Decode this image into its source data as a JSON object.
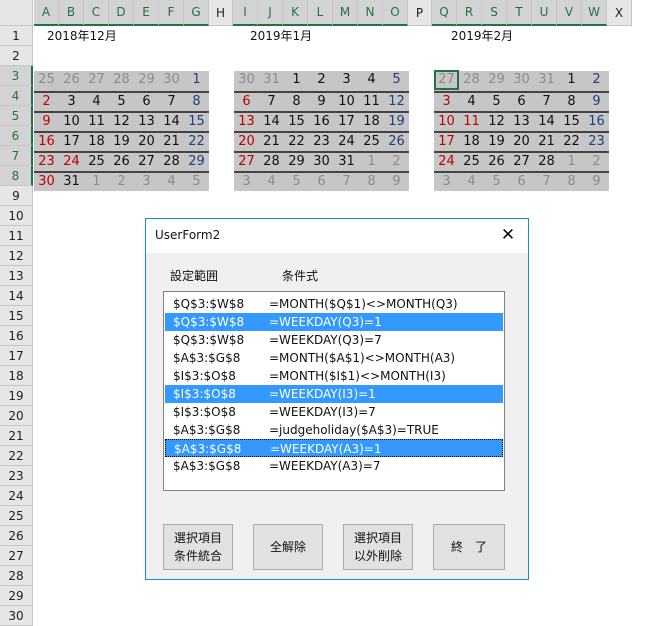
{
  "sheet": {
    "columns": [
      "A",
      "B",
      "C",
      "D",
      "E",
      "F",
      "G",
      "H",
      "I",
      "J",
      "K",
      "L",
      "M",
      "N",
      "O",
      "P",
      "Q",
      "R",
      "S",
      "T",
      "U",
      "V",
      "W",
      "X"
    ],
    "rows": [
      "1",
      "2",
      "3",
      "4",
      "5",
      "6",
      "7",
      "8",
      "9",
      "10",
      "11",
      "12",
      "13",
      "14",
      "15",
      "16",
      "17",
      "18",
      "19",
      "20",
      "21",
      "22",
      "23",
      "24",
      "25",
      "26",
      "27",
      "28",
      "29",
      "30"
    ]
  },
  "calendars": [
    {
      "title": "2018年12月",
      "weeks": [
        [
          {
            "t": "25",
            "c": "gray"
          },
          {
            "t": "26",
            "c": "gray"
          },
          {
            "t": "27",
            "c": "gray"
          },
          {
            "t": "28",
            "c": "gray"
          },
          {
            "t": "29",
            "c": "gray"
          },
          {
            "t": "30",
            "c": "gray"
          },
          {
            "t": "1",
            "c": "blue"
          }
        ],
        [
          {
            "t": "2",
            "c": "red"
          },
          {
            "t": "3",
            "c": "black"
          },
          {
            "t": "4",
            "c": "black"
          },
          {
            "t": "5",
            "c": "black"
          },
          {
            "t": "6",
            "c": "black"
          },
          {
            "t": "7",
            "c": "black"
          },
          {
            "t": "8",
            "c": "blue"
          }
        ],
        [
          {
            "t": "9",
            "c": "red"
          },
          {
            "t": "10",
            "c": "black"
          },
          {
            "t": "11",
            "c": "black"
          },
          {
            "t": "12",
            "c": "black"
          },
          {
            "t": "13",
            "c": "black"
          },
          {
            "t": "14",
            "c": "black"
          },
          {
            "t": "15",
            "c": "blue"
          }
        ],
        [
          {
            "t": "16",
            "c": "red"
          },
          {
            "t": "17",
            "c": "black"
          },
          {
            "t": "18",
            "c": "black"
          },
          {
            "t": "19",
            "c": "black"
          },
          {
            "t": "20",
            "c": "black"
          },
          {
            "t": "21",
            "c": "black"
          },
          {
            "t": "22",
            "c": "blue"
          }
        ],
        [
          {
            "t": "23",
            "c": "red"
          },
          {
            "t": "24",
            "c": "red"
          },
          {
            "t": "25",
            "c": "black"
          },
          {
            "t": "26",
            "c": "black"
          },
          {
            "t": "27",
            "c": "black"
          },
          {
            "t": "28",
            "c": "black"
          },
          {
            "t": "29",
            "c": "blue"
          }
        ],
        [
          {
            "t": "30",
            "c": "red"
          },
          {
            "t": "31",
            "c": "black"
          },
          {
            "t": "1",
            "c": "gray"
          },
          {
            "t": "2",
            "c": "gray"
          },
          {
            "t": "3",
            "c": "gray"
          },
          {
            "t": "4",
            "c": "gray"
          },
          {
            "t": "5",
            "c": "gray"
          }
        ]
      ]
    },
    {
      "title": "2019年1月",
      "weeks": [
        [
          {
            "t": "30",
            "c": "gray"
          },
          {
            "t": "31",
            "c": "gray"
          },
          {
            "t": "1",
            "c": "black"
          },
          {
            "t": "2",
            "c": "black"
          },
          {
            "t": "3",
            "c": "black"
          },
          {
            "t": "4",
            "c": "black"
          },
          {
            "t": "5",
            "c": "blue"
          }
        ],
        [
          {
            "t": "6",
            "c": "red"
          },
          {
            "t": "7",
            "c": "black"
          },
          {
            "t": "8",
            "c": "black"
          },
          {
            "t": "9",
            "c": "black"
          },
          {
            "t": "10",
            "c": "black"
          },
          {
            "t": "11",
            "c": "black"
          },
          {
            "t": "12",
            "c": "blue"
          }
        ],
        [
          {
            "t": "13",
            "c": "red"
          },
          {
            "t": "14",
            "c": "black"
          },
          {
            "t": "15",
            "c": "black"
          },
          {
            "t": "16",
            "c": "black"
          },
          {
            "t": "17",
            "c": "black"
          },
          {
            "t": "18",
            "c": "black"
          },
          {
            "t": "19",
            "c": "blue"
          }
        ],
        [
          {
            "t": "20",
            "c": "red"
          },
          {
            "t": "21",
            "c": "black"
          },
          {
            "t": "22",
            "c": "black"
          },
          {
            "t": "23",
            "c": "black"
          },
          {
            "t": "24",
            "c": "black"
          },
          {
            "t": "25",
            "c": "black"
          },
          {
            "t": "26",
            "c": "blue"
          }
        ],
        [
          {
            "t": "27",
            "c": "red"
          },
          {
            "t": "28",
            "c": "black"
          },
          {
            "t": "29",
            "c": "black"
          },
          {
            "t": "30",
            "c": "black"
          },
          {
            "t": "31",
            "c": "black"
          },
          {
            "t": "1",
            "c": "gray"
          },
          {
            "t": "2",
            "c": "gray"
          }
        ],
        [
          {
            "t": "3",
            "c": "gray"
          },
          {
            "t": "4",
            "c": "gray"
          },
          {
            "t": "5",
            "c": "gray"
          },
          {
            "t": "6",
            "c": "gray"
          },
          {
            "t": "7",
            "c": "gray"
          },
          {
            "t": "8",
            "c": "gray"
          },
          {
            "t": "9",
            "c": "gray"
          }
        ]
      ]
    },
    {
      "title": "2019年2月",
      "weeks": [
        [
          {
            "t": "27",
            "c": "gray"
          },
          {
            "t": "28",
            "c": "gray"
          },
          {
            "t": "29",
            "c": "gray"
          },
          {
            "t": "30",
            "c": "gray"
          },
          {
            "t": "31",
            "c": "gray"
          },
          {
            "t": "1",
            "c": "black"
          },
          {
            "t": "2",
            "c": "blue"
          }
        ],
        [
          {
            "t": "3",
            "c": "red"
          },
          {
            "t": "4",
            "c": "black"
          },
          {
            "t": "5",
            "c": "black"
          },
          {
            "t": "6",
            "c": "black"
          },
          {
            "t": "7",
            "c": "black"
          },
          {
            "t": "8",
            "c": "black"
          },
          {
            "t": "9",
            "c": "blue"
          }
        ],
        [
          {
            "t": "10",
            "c": "red"
          },
          {
            "t": "11",
            "c": "red"
          },
          {
            "t": "12",
            "c": "black"
          },
          {
            "t": "13",
            "c": "black"
          },
          {
            "t": "14",
            "c": "black"
          },
          {
            "t": "15",
            "c": "black"
          },
          {
            "t": "16",
            "c": "blue"
          }
        ],
        [
          {
            "t": "17",
            "c": "red"
          },
          {
            "t": "18",
            "c": "black"
          },
          {
            "t": "19",
            "c": "black"
          },
          {
            "t": "20",
            "c": "black"
          },
          {
            "t": "21",
            "c": "black"
          },
          {
            "t": "22",
            "c": "black"
          },
          {
            "t": "23",
            "c": "blue"
          }
        ],
        [
          {
            "t": "24",
            "c": "red"
          },
          {
            "t": "25",
            "c": "black"
          },
          {
            "t": "26",
            "c": "black"
          },
          {
            "t": "27",
            "c": "black"
          },
          {
            "t": "28",
            "c": "black"
          },
          {
            "t": "1",
            "c": "gray"
          },
          {
            "t": "2",
            "c": "gray"
          }
        ],
        [
          {
            "t": "3",
            "c": "gray"
          },
          {
            "t": "4",
            "c": "gray"
          },
          {
            "t": "5",
            "c": "gray"
          },
          {
            "t": "6",
            "c": "gray"
          },
          {
            "t": "7",
            "c": "gray"
          },
          {
            "t": "8",
            "c": "gray"
          },
          {
            "t": "9",
            "c": "gray"
          }
        ]
      ]
    }
  ],
  "dialog": {
    "title": "UserForm2",
    "close_glyph": "✕",
    "label_range": "設定範囲",
    "label_formula": "条件式",
    "items": [
      {
        "range": "$Q$3:$W$8",
        "formula": "=MONTH($Q$1)<>MONTH(Q3)",
        "selected": false,
        "focused": false
      },
      {
        "range": "$Q$3:$W$8",
        "formula": "=WEEKDAY(Q3)=1",
        "selected": true,
        "focused": false
      },
      {
        "range": "$Q$3:$W$8",
        "formula": "=WEEKDAY(Q3)=7",
        "selected": false,
        "focused": false
      },
      {
        "range": "$A$3:$G$8",
        "formula": "=MONTH($A$1)<>MONTH(A3)",
        "selected": false,
        "focused": false
      },
      {
        "range": "$I$3:$O$8",
        "formula": "=MONTH($I$1)<>MONTH(I3)",
        "selected": false,
        "focused": false
      },
      {
        "range": "$I$3:$O$8",
        "formula": "=WEEKDAY(I3)=1",
        "selected": true,
        "focused": false
      },
      {
        "range": "$I$3:$O$8",
        "formula": "=WEEKDAY(I3)=7",
        "selected": false,
        "focused": false
      },
      {
        "range": "$A$3:$G$8",
        "formula": "=judgeholiday($A$3)=TRUE",
        "selected": false,
        "focused": false
      },
      {
        "range": "$A$3:$G$8",
        "formula": "=WEEKDAY(A3)=1",
        "selected": true,
        "focused": true
      },
      {
        "range": "$A$3:$G$8",
        "formula": "=WEEKDAY(A3)=7",
        "selected": false,
        "focused": false
      }
    ],
    "buttons": {
      "merge": "選択項目\n条件統合",
      "clear_all": "全解除",
      "delete_others": "選択項目\n以外削除",
      "end": "終　了"
    }
  },
  "colors": {
    "header_bg": "#e6e6e6",
    "selected_accent": "#217346",
    "calendar_bg": "#c6c6c6",
    "list_highlight": "#3399ff",
    "sunday_red": "#c00000",
    "saturday_blue": "#1f3f7f"
  }
}
